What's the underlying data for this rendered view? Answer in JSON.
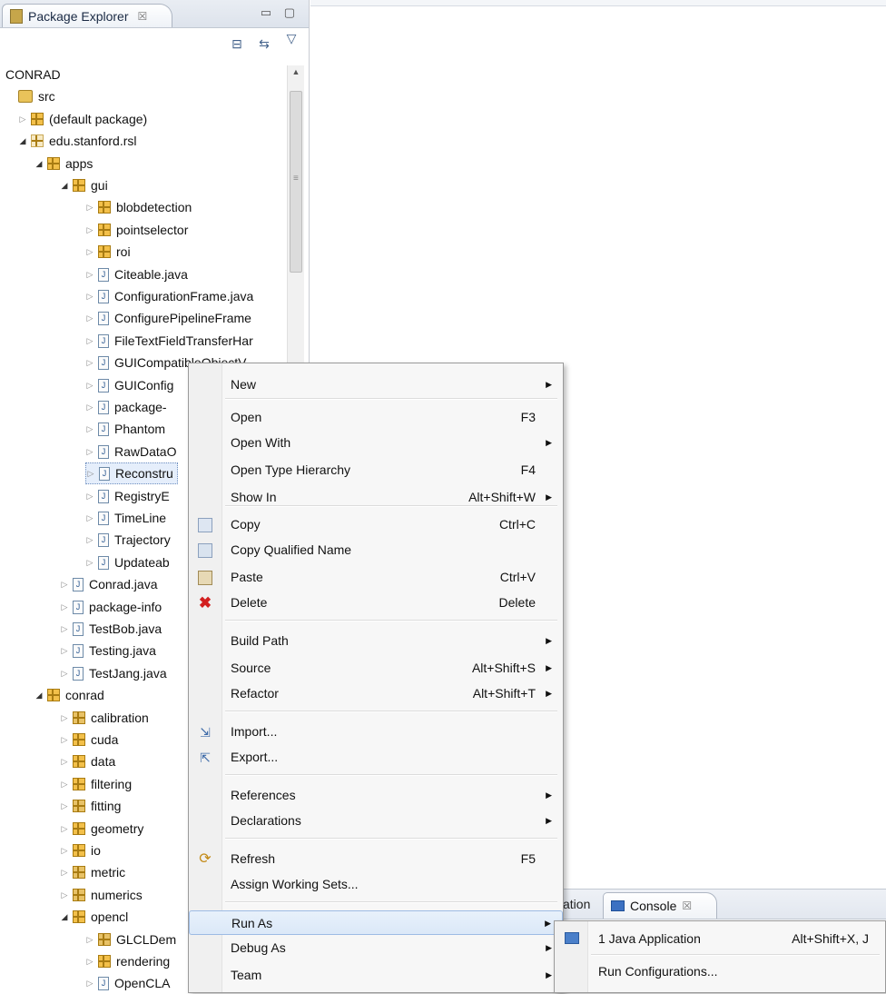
{
  "explorer": {
    "title": "Package Explorer",
    "close_glyph": "☒",
    "window_controls": "▭ ▢",
    "toolbar": {
      "collapse_icon": "collapse-all-icon",
      "link_icon": "link-with-editor-icon",
      "menu_icon": "view-menu-icon"
    },
    "tree": [
      {
        "label": "CONRAD",
        "level": 0,
        "twisty": "",
        "icon": "none"
      },
      {
        "label": "src",
        "level": 0,
        "twisty": "",
        "icon": "src"
      },
      {
        "label": "(default package)",
        "level": 1,
        "twisty": "▷",
        "icon": "pkg"
      },
      {
        "label": "edu.stanford.rsl",
        "level": 1,
        "twisty": "◢",
        "icon": "pkgempty"
      },
      {
        "label": "apps",
        "level": 2,
        "twisty": "◢",
        "icon": "pkg"
      },
      {
        "label": "gui",
        "level": 3,
        "twisty": "◢",
        "icon": "pkg"
      },
      {
        "label": "blobdetection",
        "level": 4,
        "twisty": "▷",
        "icon": "pkg"
      },
      {
        "label": "pointselector",
        "level": 4,
        "twisty": "▷",
        "icon": "pkg"
      },
      {
        "label": "roi",
        "level": 4,
        "twisty": "▷",
        "icon": "pkg"
      },
      {
        "label": "Citeable.java",
        "level": 4,
        "twisty": "▷",
        "icon": "java"
      },
      {
        "label": "ConfigurationFrame.java",
        "level": 4,
        "twisty": "▷",
        "icon": "java"
      },
      {
        "label": "ConfigurePipelineFrame",
        "level": 4,
        "twisty": "▷",
        "icon": "java"
      },
      {
        "label": "FileTextFieldTransferHar",
        "level": 4,
        "twisty": "▷",
        "icon": "java"
      },
      {
        "label": "GUICompatibleObjectV",
        "level": 4,
        "twisty": "▷",
        "icon": "java"
      },
      {
        "label": "GUIConfig",
        "level": 4,
        "twisty": "▷",
        "icon": "java"
      },
      {
        "label": "package-",
        "level": 4,
        "twisty": "▷",
        "icon": "java"
      },
      {
        "label": "Phantom",
        "level": 4,
        "twisty": "▷",
        "icon": "java"
      },
      {
        "label": "RawDataO",
        "level": 4,
        "twisty": "▷",
        "icon": "java"
      },
      {
        "label": "Reconstru",
        "level": 4,
        "twisty": "▷",
        "icon": "java",
        "selected": true
      },
      {
        "label": "RegistryE",
        "level": 4,
        "twisty": "▷",
        "icon": "java"
      },
      {
        "label": "TimeLine",
        "level": 4,
        "twisty": "▷",
        "icon": "java"
      },
      {
        "label": "Trajectory",
        "level": 4,
        "twisty": "▷",
        "icon": "java"
      },
      {
        "label": "Updateab",
        "level": 4,
        "twisty": "▷",
        "icon": "java"
      },
      {
        "label": "Conrad.java",
        "level": 3,
        "twisty": "▷",
        "icon": "java"
      },
      {
        "label": "package-info",
        "level": 3,
        "twisty": "▷",
        "icon": "java"
      },
      {
        "label": "TestBob.java",
        "level": 3,
        "twisty": "▷",
        "icon": "java"
      },
      {
        "label": "Testing.java",
        "level": 3,
        "twisty": "▷",
        "icon": "java"
      },
      {
        "label": "TestJang.java",
        "level": 3,
        "twisty": "▷",
        "icon": "java"
      },
      {
        "label": "conrad",
        "level": 2,
        "twisty": "◢",
        "icon": "pkg"
      },
      {
        "label": "calibration",
        "level": 3,
        "twisty": "▷",
        "icon": "pkgdec"
      },
      {
        "label": "cuda",
        "level": 3,
        "twisty": "▷",
        "icon": "pkg"
      },
      {
        "label": "data",
        "level": 3,
        "twisty": "▷",
        "icon": "pkg"
      },
      {
        "label": "filtering",
        "level": 3,
        "twisty": "▷",
        "icon": "pkg"
      },
      {
        "label": "fitting",
        "level": 3,
        "twisty": "▷",
        "icon": "pkgdec"
      },
      {
        "label": "geometry",
        "level": 3,
        "twisty": "▷",
        "icon": "pkg"
      },
      {
        "label": "io",
        "level": 3,
        "twisty": "▷",
        "icon": "pkg"
      },
      {
        "label": "metric",
        "level": 3,
        "twisty": "▷",
        "icon": "pkgdec"
      },
      {
        "label": "numerics",
        "level": 3,
        "twisty": "▷",
        "icon": "pkgdec"
      },
      {
        "label": "opencl",
        "level": 3,
        "twisty": "◢",
        "icon": "pkg"
      },
      {
        "label": "GLCLDem",
        "level": 4,
        "twisty": "▷",
        "icon": "pkgdec"
      },
      {
        "label": "rendering",
        "level": 4,
        "twisty": "▷",
        "icon": "pkg"
      },
      {
        "label": "OpenCLA",
        "level": 4,
        "twisty": "▷",
        "icon": "java"
      }
    ]
  },
  "bottom_panel": {
    "partial_tab": "ation",
    "console_tab": "Console",
    "close_glyph": "☒"
  },
  "context_menu": {
    "items": [
      {
        "label": "New",
        "accel": "",
        "submenu": true,
        "icon": ""
      },
      {
        "label": "Open",
        "accel": "F3",
        "submenu": false,
        "icon": ""
      },
      {
        "label": "Open With",
        "accel": "",
        "submenu": true,
        "icon": ""
      },
      {
        "label": "Open Type Hierarchy",
        "accel": "F4",
        "submenu": false,
        "icon": ""
      },
      {
        "label": "Show In",
        "accel": "Alt+Shift+W",
        "submenu": true,
        "icon": ""
      },
      {
        "label": "Copy",
        "accel": "Ctrl+C",
        "submenu": false,
        "icon": "copy-icon"
      },
      {
        "label": "Copy Qualified Name",
        "accel": "",
        "submenu": false,
        "icon": "copy-qualified-name-icon"
      },
      {
        "label": "Paste",
        "accel": "Ctrl+V",
        "submenu": false,
        "icon": "paste-icon"
      },
      {
        "label": "Delete",
        "accel": "Delete",
        "submenu": false,
        "icon": "delete-icon"
      },
      {
        "label": "Build Path",
        "accel": "",
        "submenu": true,
        "icon": ""
      },
      {
        "label": "Source",
        "accel": "Alt+Shift+S",
        "submenu": true,
        "icon": ""
      },
      {
        "label": "Refactor",
        "accel": "Alt+Shift+T",
        "submenu": true,
        "icon": ""
      },
      {
        "label": "Import...",
        "accel": "",
        "submenu": false,
        "icon": "import-icon"
      },
      {
        "label": "Export...",
        "accel": "",
        "submenu": false,
        "icon": "export-icon"
      },
      {
        "label": "References",
        "accel": "",
        "submenu": true,
        "icon": ""
      },
      {
        "label": "Declarations",
        "accel": "",
        "submenu": true,
        "icon": ""
      },
      {
        "label": "Refresh",
        "accel": "F5",
        "submenu": false,
        "icon": "refresh-icon"
      },
      {
        "label": "Assign Working Sets...",
        "accel": "",
        "submenu": false,
        "icon": ""
      },
      {
        "label": "Run As",
        "accel": "",
        "submenu": true,
        "icon": "",
        "hover": true
      },
      {
        "label": "Debug As",
        "accel": "",
        "submenu": true,
        "icon": ""
      },
      {
        "label": "Team",
        "accel": "",
        "submenu": true,
        "icon": ""
      }
    ]
  },
  "submenu": {
    "items": [
      {
        "label": "1 Java Application",
        "accel": "Alt+Shift+X, J",
        "icon": "java-application-icon"
      },
      {
        "label": "Run Configurations...",
        "accel": "",
        "icon": ""
      }
    ]
  },
  "glyphs": {
    "submenu_arrow": "▶"
  }
}
